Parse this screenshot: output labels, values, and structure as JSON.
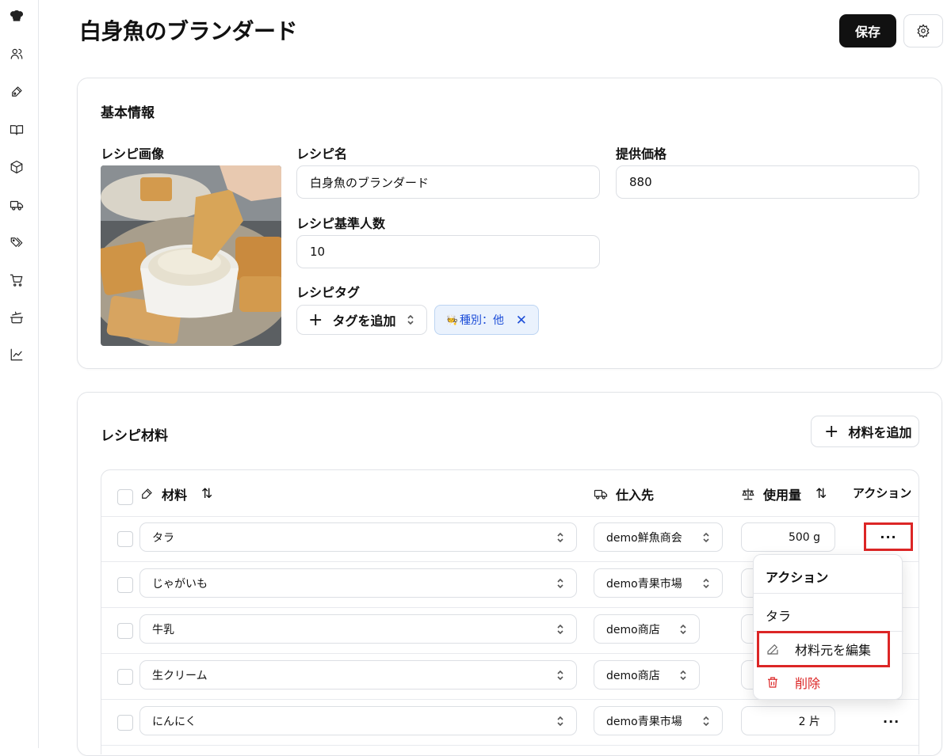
{
  "page": {
    "title": "白身魚のブランダード"
  },
  "header": {
    "save_label": "保存"
  },
  "basic_info": {
    "title": "基本情報",
    "image_label": "レシピ画像",
    "name_label": "レシピ名",
    "name_value": "白身魚のブランダード",
    "price_label": "提供価格",
    "price_value": "880",
    "servings_label": "レシピ基準人数",
    "servings_value": "10",
    "tags_label": "レシピタグ",
    "add_tag_label": "タグを追加",
    "tags": [
      {
        "label": "種別：他"
      }
    ]
  },
  "ingredients": {
    "title": "レシピ材料",
    "add_label": "材料を追加",
    "columns": {
      "ingredient": "材料",
      "supplier": "仕入先",
      "amount": "使用量",
      "action": "アクション"
    },
    "rows": [
      {
        "name": "タラ",
        "supplier": "demo鮮魚商会",
        "amount": "500 g"
      },
      {
        "name": "じゃがいも",
        "supplier": "demo青果市場",
        "amount": ""
      },
      {
        "name": "牛乳",
        "supplier": "demo商店",
        "amount": ""
      },
      {
        "name": "生クリーム",
        "supplier": "demo商店",
        "amount": ""
      },
      {
        "name": "にんにく",
        "supplier": "demo青果市場",
        "amount": "2 片"
      }
    ],
    "more_label": "···"
  },
  "action_menu": {
    "title": "アクション",
    "subtitle": "タラ",
    "edit_label": "材料元を編集",
    "delete_label": "削除"
  },
  "colors": {
    "primary": "#111111",
    "danger": "#dc2626",
    "tag_bg": "#eaf2fd",
    "tag_text": "#1d4ed8"
  },
  "icons": [
    "chef-hat-icon",
    "users-icon",
    "pen-tool-icon",
    "book-open-icon",
    "package-icon",
    "truck-icon",
    "tags-icon",
    "cart-icon",
    "cooking-pot-icon",
    "chart-icon"
  ]
}
